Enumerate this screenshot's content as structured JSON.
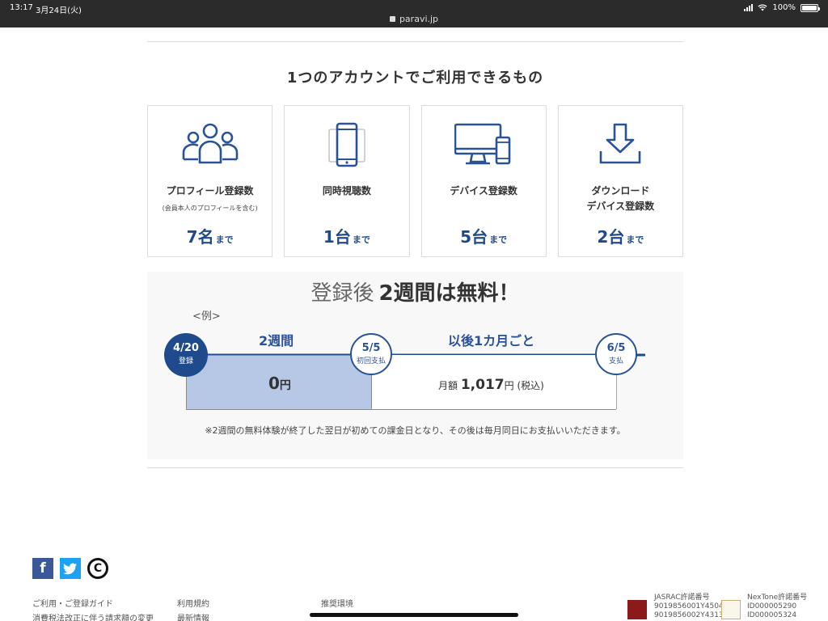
{
  "status_bar": {
    "time": "13:17",
    "date": "3月24日(火)",
    "url": "paravi.jp",
    "battery": "100%",
    "battery_level": 1.0
  },
  "section": {
    "title": "1つのアカウントでご利用できるもの",
    "cards": [
      {
        "icon": "users-icon",
        "label": "プロフィール登録数",
        "sub": "(会員本人のプロフィールを含む)",
        "value": "7名",
        "unit": "まで"
      },
      {
        "icon": "smartphone-icon",
        "label": "同時視聴数",
        "sub": "",
        "value": "1台",
        "unit": "まで"
      },
      {
        "icon": "devices-icon",
        "label": "デバイス登録数",
        "sub": "",
        "value": "5台",
        "unit": "まで"
      },
      {
        "icon": "download-icon",
        "label": "ダウンロード\nデバイス登録数",
        "sub": "",
        "value": "2台",
        "unit": "まで"
      }
    ]
  },
  "trial": {
    "title_prefix": "登録後",
    "title_main": "2週間は無料！",
    "example": "<例>",
    "period_free": "2週間",
    "period_after": "以後1カ月ごと",
    "nodes": [
      {
        "date": "4/20",
        "text": "登録"
      },
      {
        "date": "5/5",
        "text": "初回支払"
      },
      {
        "date": "6/5",
        "text": "支払"
      }
    ],
    "free_price": "0",
    "free_unit": "円",
    "monthly_prefix": "月額",
    "monthly_price": "1,017",
    "monthly_unit": "円",
    "monthly_tax": "(税込)",
    "note": "※2週間の無料体験が終了した翌日が初めての課金日となり、その後は毎月同日にお支払いいただきます。"
  },
  "footer": {
    "social": [
      {
        "icon": "facebook-icon",
        "glyph": "f"
      },
      {
        "icon": "twitter-icon",
        "glyph": "t"
      },
      {
        "icon": "c-logo-icon",
        "glyph": "C"
      }
    ],
    "links": [
      "ご利用・ご登録ガイド",
      "消費税法改正に伴う請求額の変更",
      "利用規約",
      "最新情報",
      "推奨環境"
    ],
    "jasrac_title": "JASRAC許諾番号",
    "jasrac_1": "9019856001Y45040",
    "jasrac_2": "9019856002Y43136",
    "nextone_title": "NexTone許諾番号",
    "nextone_1": "ID000005290",
    "nextone_2": "ID000005324"
  }
}
